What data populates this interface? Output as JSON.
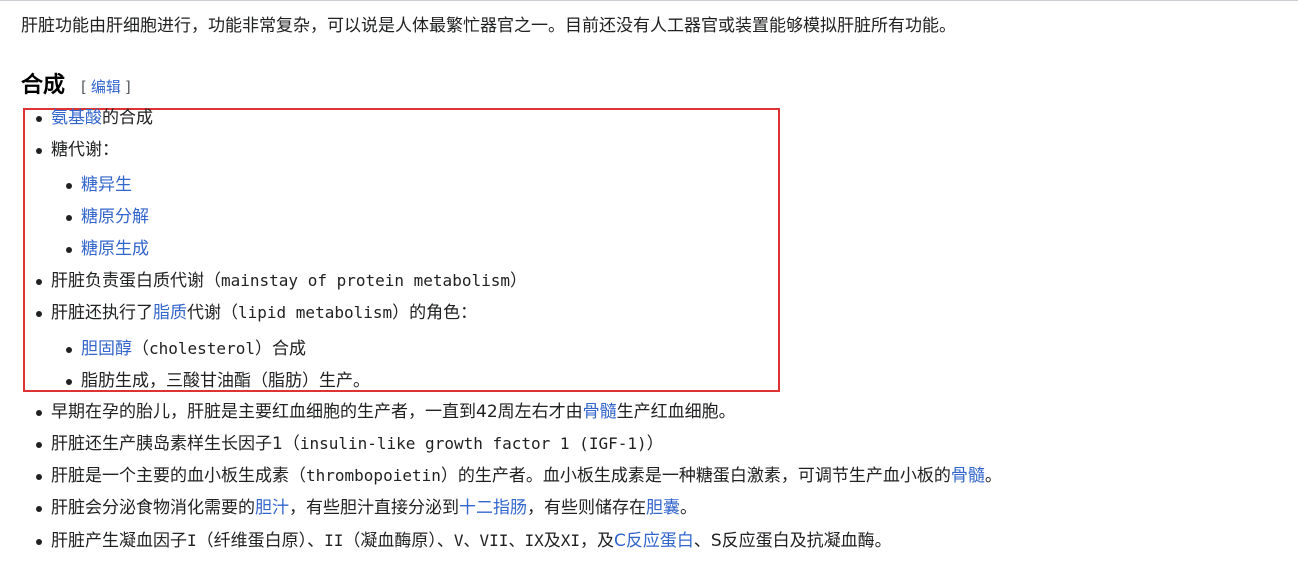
{
  "intro": "肝脏功能由肝细胞进行，功能非常复杂，可以说是人体最繁忙器官之一。目前还没有人工器官或装置能够模拟肝脏所有功能。",
  "section": {
    "title": "合成",
    "edit_open": "[",
    "edit_label": "编辑",
    "edit_close": "]"
  },
  "items": {
    "amino": {
      "link": "氨基酸",
      "rest": "的合成"
    },
    "carb": {
      "text": "糖代谢："
    },
    "gluconeo": {
      "link": "糖异生"
    },
    "glycogenolysis": {
      "link": "糖原分解"
    },
    "glycogenesis": {
      "link": "糖原生成"
    },
    "protein": {
      "text_a": "肝脏负责蛋白质代谢（",
      "term": "mainstay of protein metabolism",
      "text_b": "）"
    },
    "lipid": {
      "text_a": "肝脏还执行了",
      "link": "脂质",
      "text_b": "代谢（",
      "term": "lipid metabolism",
      "text_c": "）的角色："
    },
    "cholesterol": {
      "link": "胆固醇",
      "text_a": "（",
      "term": "cholesterol",
      "text_b": "）合成"
    },
    "triglyceride": {
      "text": "脂肪生成，三酸甘油酯（脂肪）生产。"
    },
    "fetal": {
      "text_a": "早期在孕的胎儿，肝脏是主要红血细胞的生产者，一直到42周左右才由",
      "link": "骨髓",
      "text_b": "生产红血细胞。"
    },
    "igf": {
      "text_a": "肝脏还生产胰岛素样生长因子1（",
      "term": "insulin-like growth factor 1 (IGF-1)",
      "text_b": "）"
    },
    "tpo": {
      "text_a": "肝脏是一个主要的血小板生成素（",
      "term": "thrombopoietin",
      "text_b": "）的生产者。血小板生成素是一种糖蛋白激素，可调节生产血小板的",
      "link": "骨髓",
      "text_c": "。"
    },
    "bile": {
      "text_a": "肝脏会分泌食物消化需要的",
      "link_a": "胆汁",
      "text_b": "，有些胆汁直接分泌到",
      "link_b": "十二指肠",
      "text_c": "，有些则储存在",
      "link_c": "胆囊",
      "text_d": "。"
    },
    "coag": {
      "text_a": "肝脏产生凝血因子",
      "term_a": "I",
      "text_b": "（纤维蛋白原）、",
      "term_b": "II",
      "text_c": "（凝血酶原）、",
      "term_c": "V、VII、IX",
      "text_d": "及",
      "term_d": "XI",
      "text_e": "，及",
      "link": "C反应蛋白",
      "text_f": "、S反应蛋白及抗凝血酶。"
    }
  }
}
